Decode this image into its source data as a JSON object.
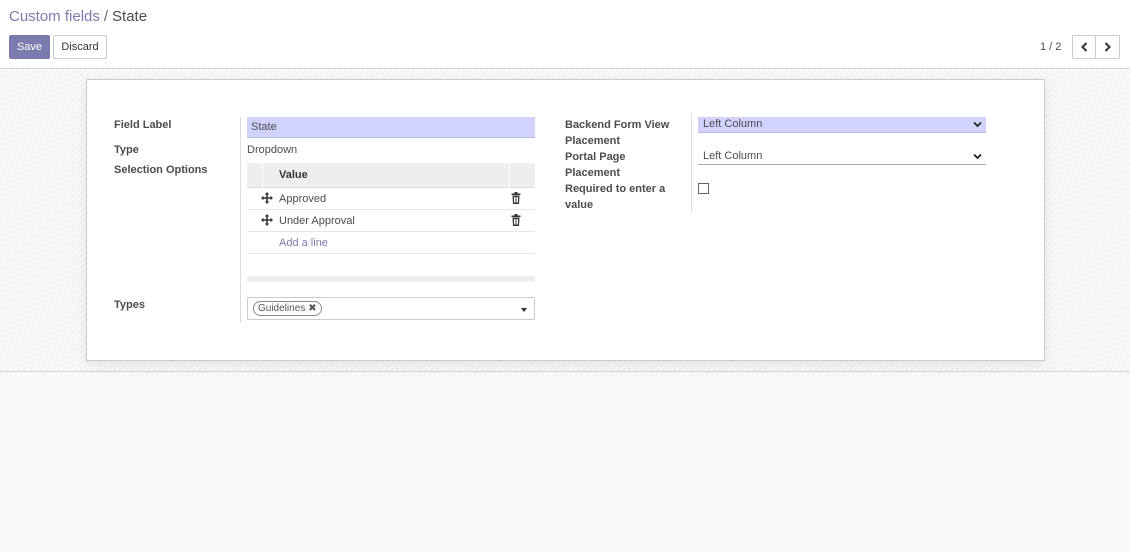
{
  "breadcrumb": {
    "parent": "Custom fields",
    "separator": "/",
    "current": "State"
  },
  "toolbar": {
    "save_label": "Save",
    "discard_label": "Discard"
  },
  "pager": {
    "value": "1 / 2"
  },
  "colors": {
    "accent": "#7c7bad",
    "required_field_bg": "#d2d2ff"
  },
  "form": {
    "left": {
      "field_label": {
        "label": "Field Label",
        "value": "State"
      },
      "type": {
        "label": "Type",
        "value": "Dropdown"
      },
      "selection_options": {
        "label": "Selection Options",
        "column_header": "Value",
        "rows": [
          "Approved",
          "Under Approval"
        ],
        "add_line": "Add a line"
      },
      "types": {
        "label": "Types",
        "tags": [
          "Guidelines"
        ]
      }
    },
    "right": {
      "backend_placement": {
        "label_line1": "Backend Form View",
        "label_line2": "Placement",
        "value": "Left Column"
      },
      "portal_placement": {
        "label_line1": "Portal Page",
        "label_line2": "Placement",
        "value": "Left Column"
      },
      "required": {
        "label_line1": "Required to enter a",
        "label_line2": "value",
        "checked": false
      }
    }
  },
  "icons": {
    "pager_prev": "chevron-left-icon",
    "pager_next": "chevron-right-icon",
    "row_handle": "drag-handle-icon",
    "row_delete": "trash-icon",
    "select_caret": "chevron-down-icon"
  }
}
